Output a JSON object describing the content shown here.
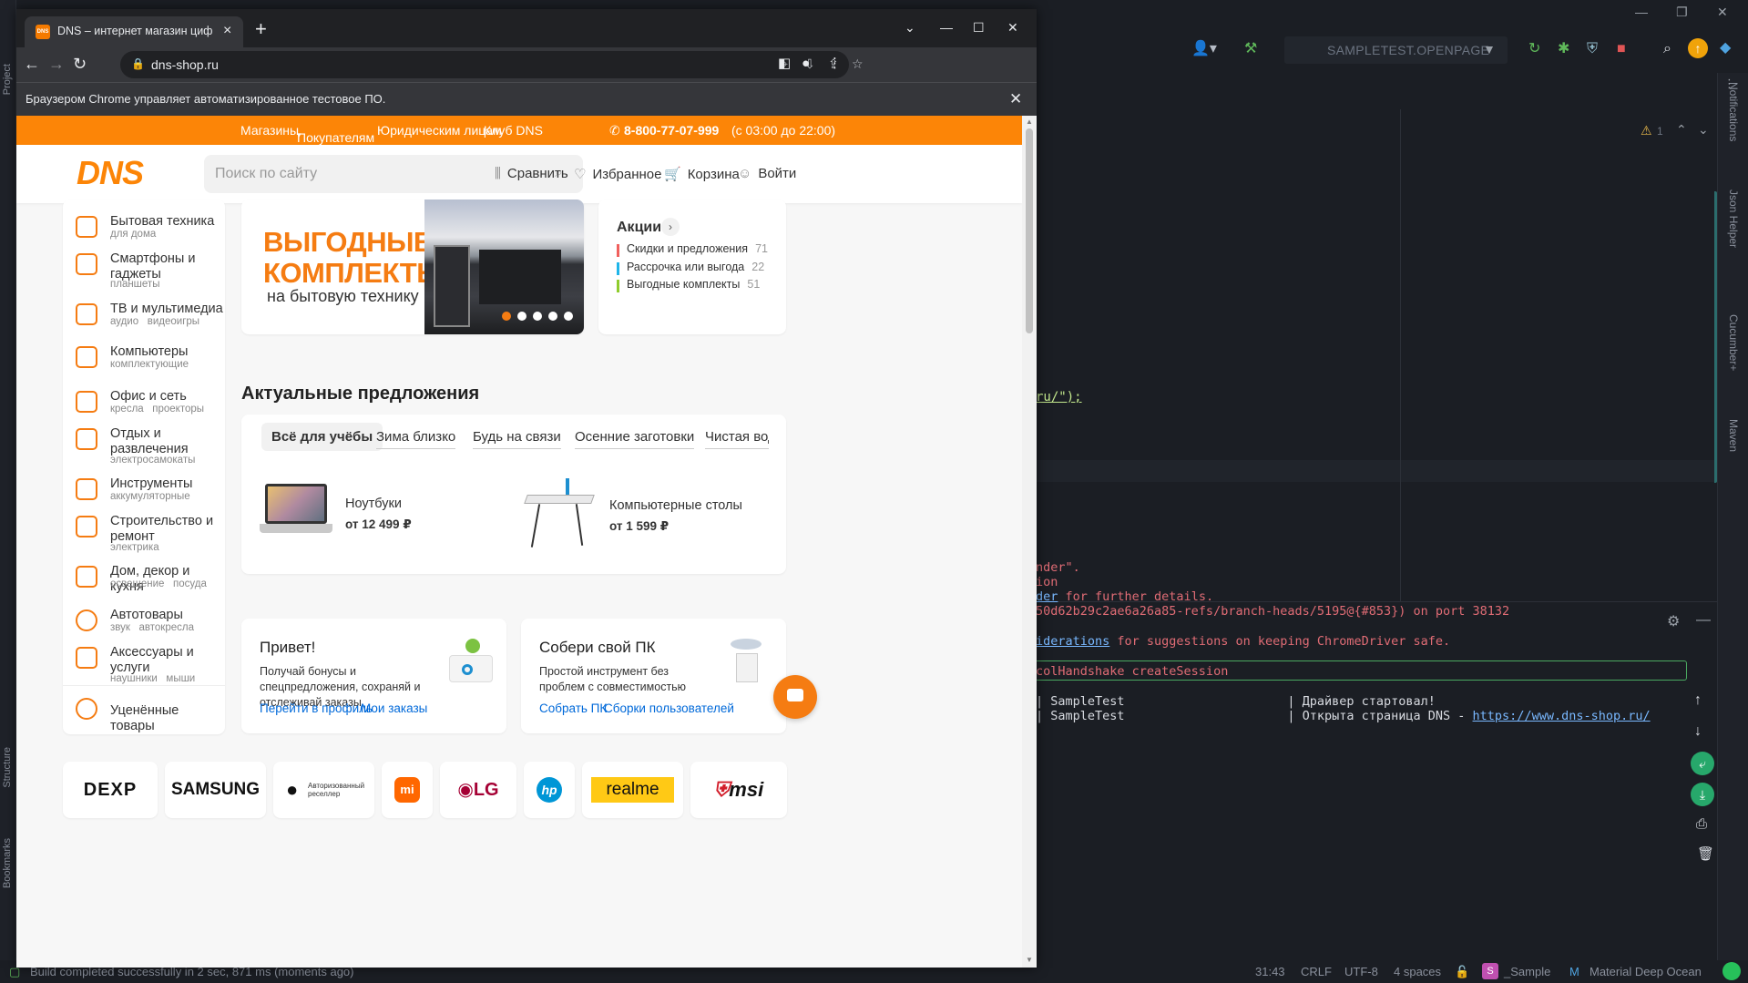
{
  "ide": {
    "left_labels": [
      "Project",
      "Structure",
      "Bookmarks"
    ],
    "run_config": "SAMPLETEST.OPENPAGE",
    "right_labels": [
      "Notifications",
      "Json Helper",
      "Cucumber+",
      "Maven"
    ],
    "warning_count": "1",
    "code_line": "ru/\");",
    "console_lines": [
      {
        "text": "nder\".",
        "style": "red"
      },
      {
        "text": "ion",
        "style": "red"
      },
      {
        "text_link": "der",
        "text": " for further details.",
        "style": "red"
      },
      {
        "text": "50d62b29c2ae6a26a85-refs/branch-heads/5195@{#853}) on port 38132",
        "style": "red"
      },
      {
        "text_link": "iderations",
        "text": " for suggestions on keeping ChromeDriver safe.",
        "style": "red"
      },
      {
        "text": "colHandshake createSession",
        "style": "red"
      },
      {
        "text": "| SampleTest                      | Драйвер стартовал!",
        "style": "white"
      },
      {
        "text": "| SampleTest                      | Открыта страница DNS - ",
        "link": "https://www.dns-shop.ru/",
        "style": "white"
      }
    ],
    "status": {
      "build": "Build completed successfully in 2 sec, 871 ms (moments ago)",
      "position": "31:43",
      "line_sep": "CRLF",
      "encoding": "UTF-8",
      "indent": "4 spaces",
      "module": "_Sample",
      "theme": "Material Deep Ocean"
    }
  },
  "browser": {
    "tab_title": "DNS – интернет магазин цифровой",
    "favicon_text": "DNS",
    "url": "dns-shop.ru",
    "infobar": "Браузером Chrome управляет автоматизированное тестовое ПО."
  },
  "site": {
    "topbar": {
      "links": [
        "Магазины",
        "Покупателям",
        "Юридическим лицам",
        "Клуб DNS"
      ],
      "phone": "8-800-77-07-999",
      "hours": "(с 03:00 до 22:00)"
    },
    "logo": "DNS",
    "search_placeholder": "Поиск по сайту",
    "header_links": {
      "compare": "Сравнить",
      "favorites": "Избранное",
      "cart": "Корзина",
      "login": "Войти"
    },
    "categories": [
      {
        "title": "Бытовая техника",
        "sub": "для дома"
      },
      {
        "title": "Смартфоны и гаджеты",
        "sub": "планшеты"
      },
      {
        "title": "ТВ и мультимедиа",
        "sub": "аудио   видеоигры"
      },
      {
        "title": "Компьютеры",
        "sub": "комплектующие"
      },
      {
        "title": "Офис и сеть",
        "sub": "кресла   проекторы"
      },
      {
        "title": "Отдых и развлечения",
        "sub": "электросамокаты"
      },
      {
        "title": "Инструменты",
        "sub": "аккумуляторные"
      },
      {
        "title": "Строительство и ремонт",
        "sub": "электрика"
      },
      {
        "title": "Дом, декор и кухня",
        "sub": "освещение   посуда"
      },
      {
        "title": "Автотовары",
        "sub": "звук   автокресла"
      },
      {
        "title": "Аксессуары и услуги",
        "sub": "наушники   мыши"
      },
      {
        "title": "Уценённые товары",
        "sub": ""
      }
    ],
    "banner": {
      "title_line1": "ВЫГОДНЫЕ",
      "title_line2": "КОМПЛЕКТЫ",
      "subtitle": "на бытовую технику"
    },
    "promos": {
      "title": "Акции",
      "items": [
        {
          "label": "Скидки и предложения",
          "count": "71",
          "color": "#f0605d"
        },
        {
          "label": "Рассрочка или выгода",
          "count": "22",
          "color": "#1fb5e9"
        },
        {
          "label": "Выгодные комплекты",
          "count": "51",
          "color": "#8fcc2c"
        }
      ]
    },
    "offers": {
      "title": "Актуальные предложения",
      "tabs": [
        "Всё для учёбы",
        "Зима близко",
        "Будь на связи",
        "Осенние заготовки",
        "Чистая вода"
      ],
      "products": [
        {
          "name": "Ноутбуки",
          "price": "от 12 499 ₽"
        },
        {
          "name": "Компьютерные столы",
          "price": "от 1 599 ₽"
        }
      ]
    },
    "hello": {
      "title": "Привет!",
      "text": "Получай бонусы и спецпредложения, сохраняй и отслеживай заказы",
      "links": [
        "Перейти в профиль",
        "Мои заказы"
      ]
    },
    "pc": {
      "title": "Собери свой ПК",
      "text": "Простой инструмент без проблем с совместимостью",
      "links": [
        "Собрать ПК",
        "Сборки пользователей"
      ]
    },
    "brands": [
      "DEXP",
      "SAMSUNG",
      "Авторизованный реселлер",
      "mi",
      "LG",
      "hp",
      "realme",
      "msi"
    ]
  }
}
